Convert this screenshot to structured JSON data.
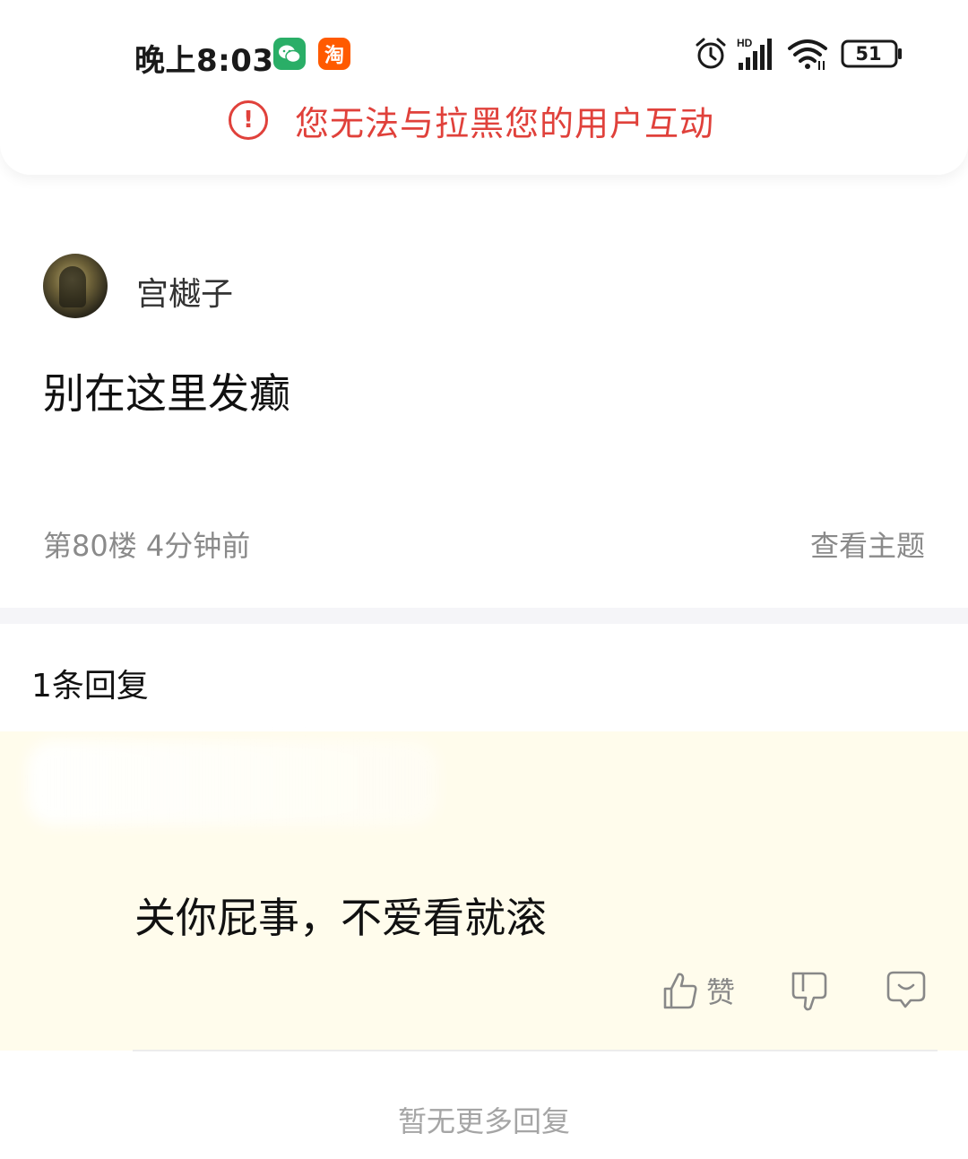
{
  "status_bar": {
    "time": "晚上8:03",
    "taobao_glyph": "淘",
    "battery_level": "51",
    "hd_label": "HD",
    "icons": [
      "wechat-icon",
      "taobao-icon",
      "alarm-icon",
      "signal-icon",
      "wifi-icon",
      "battery-icon"
    ]
  },
  "warning": {
    "text": "您无法与拉黑您的用户互动",
    "icon": "exclamation-circle-icon",
    "color": "#e0413b"
  },
  "post": {
    "username": "宫樾子",
    "content": "别在这里发癫",
    "meta": "第80楼  4分钟前",
    "view_topic": "查看主题"
  },
  "replies": {
    "count_label": "1条回复",
    "items": [
      {
        "text": "关你屁事，不爱看就滚",
        "like_label": "赞"
      }
    ],
    "no_more": "暂无更多回复"
  }
}
